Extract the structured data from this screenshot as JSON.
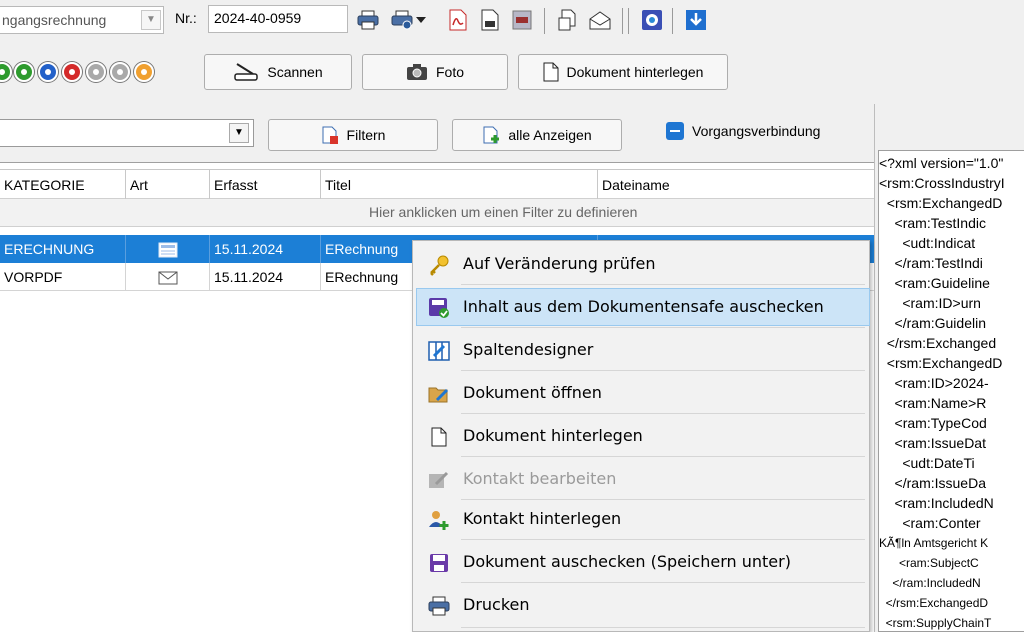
{
  "toolbar": {
    "type_value": "ngangsrechnung",
    "nr_label": "Nr.:",
    "nr_value": "2024-40-0959"
  },
  "buttons": {
    "scan": "Scannen",
    "photo": "Foto",
    "deposit": "Dokument hinterlegen",
    "filter": "Filtern",
    "show_all": "alle Anzeigen",
    "link_toggle": "Vorgangsverbindung"
  },
  "grid": {
    "columns": [
      "KATEGORIE",
      "Art",
      "Erfasst",
      "Titel",
      "Dateiname"
    ],
    "filter_hint": "Hier anklicken um einen Filter zu definieren",
    "rows": [
      {
        "kategorie": "ERECHNUNG",
        "erfasst": "15.11.2024",
        "titel": "ERechnung",
        "art_icon": "invoice-icon",
        "selected": true
      },
      {
        "kategorie": "VORPDF",
        "erfasst": "15.11.2024",
        "titel": "ERechnung",
        "art_icon": "envelope-icon",
        "selected": false
      }
    ]
  },
  "xml_lines": [
    "<?xml version=\"1.0\"",
    "<rsm:CrossIndustryI",
    "  <rsm:ExchangedD",
    "    <ram:TestIndic",
    "      <udt:Indicat",
    "    </ram:TestIndi",
    "    <ram:Guideline",
    "      <ram:ID>urn",
    "    </ram:Guidelin",
    "  </rsm:Exchanged",
    "  <rsm:ExchangedD",
    "    <ram:ID>2024-",
    "    <ram:Name>R",
    "    <ram:TypeCod",
    "    <ram:IssueDat",
    "      <udt:DateTi",
    "    </ram:IssueDa",
    "    <ram:IncludedN",
    "      <ram:Conter",
    "KÃ¶ln Amtsgericht K",
    "      <ram:SubjectC",
    "    </ram:IncludedN",
    "  </rsm:ExchangedD",
    "  <rsm:SupplyChainT"
  ],
  "context_menu": {
    "items": [
      {
        "label": "Auf Veränderung prüfen",
        "icon": "key-icon",
        "disabled": false,
        "highlighted": false
      },
      {
        "label": "Inhalt aus dem Dokumentensafe auschecken",
        "icon": "safe-checkout-icon",
        "disabled": false,
        "highlighted": true
      },
      {
        "label": "Spaltendesigner",
        "icon": "column-designer-icon",
        "disabled": false,
        "highlighted": false
      },
      {
        "label": "Dokument öffnen",
        "icon": "open-folder-icon",
        "disabled": false,
        "highlighted": false
      },
      {
        "label": "Dokument hinterlegen",
        "icon": "document-icon",
        "disabled": false,
        "highlighted": false
      },
      {
        "label": "Kontakt bearbeiten",
        "icon": "edit-contact-icon",
        "disabled": true,
        "highlighted": false
      },
      {
        "label": "Kontakt hinterlegen",
        "icon": "add-contact-icon",
        "disabled": false,
        "highlighted": false
      },
      {
        "label": "Dokument auschecken (Speichern unter)",
        "icon": "save-icon",
        "disabled": false,
        "highlighted": false
      },
      {
        "label": "Drucken",
        "icon": "printer-icon",
        "disabled": false,
        "highlighted": false
      }
    ]
  },
  "colors": {
    "selection": "#1c7fd6",
    "menu_highlight": "#cce4f7",
    "toolbar_bg": "#f0f0f0"
  }
}
